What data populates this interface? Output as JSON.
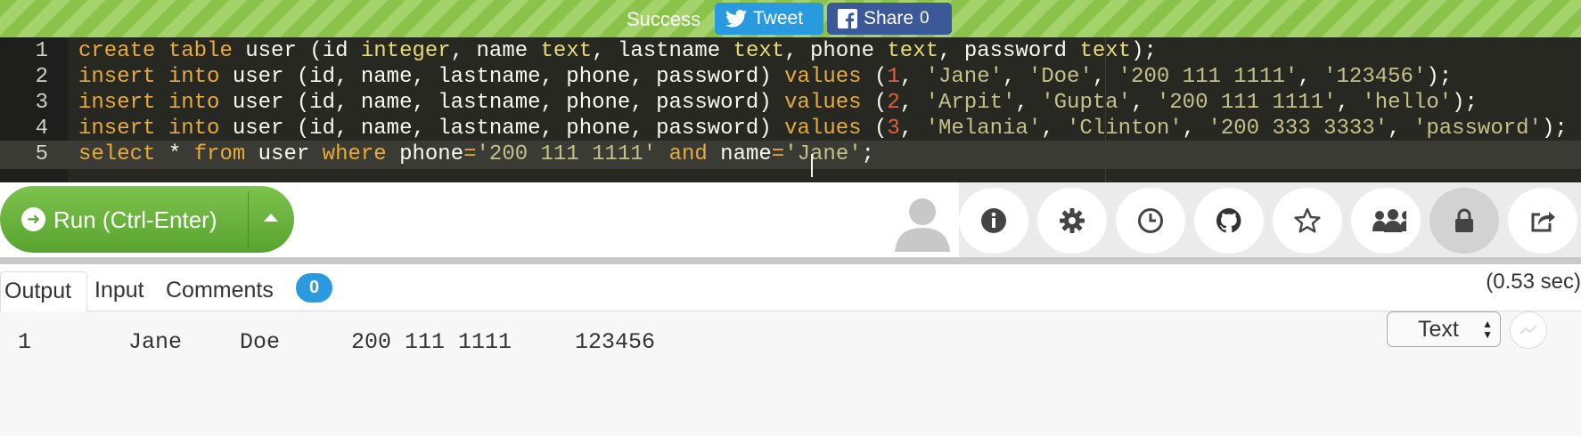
{
  "status_bar": {
    "status": "Success",
    "tweet_label": "Tweet",
    "share_label": "Share",
    "share_count": "0"
  },
  "editor": {
    "line_numbers": [
      "1",
      "2",
      "3",
      "4",
      "5"
    ],
    "lines": [
      "create table user (id integer, name text, lastname text, phone text, password text);",
      "insert into user (id, name, lastname, phone, password) values (1, 'Jane', 'Doe', '200 111 1111', '123456');",
      "insert into user (id, name, lastname, phone, password) values (2, 'Arpit', 'Gupta', '200 111 1111', 'hello');",
      "insert into user (id, name, lastname, phone, password) values (3, 'Melania', 'Clinton', '200 333 3333', 'password');",
      "select * from user where phone='200 111 1111' and name='Jane';"
    ]
  },
  "toolbar": {
    "run_label": "Run (Ctrl-Enter)",
    "icons": [
      "info-icon",
      "gear-icon",
      "history-icon",
      "github-icon",
      "star-icon",
      "users-icon",
      "lock-icon",
      "share-out-icon"
    ]
  },
  "tabs": {
    "output": "Output",
    "input": "Input",
    "comments": "Comments",
    "comments_count": "0"
  },
  "exec_time": "(0.53 sec)",
  "output": {
    "row": [
      "1",
      "Jane",
      "Doe",
      "200 111 1111",
      "123456"
    ],
    "format": "Text"
  },
  "colors": {
    "success_green": "#8bc34a",
    "run_green": "#58a32f",
    "tweet_blue": "#2a9ae0",
    "facebook_blue": "#3b5998",
    "editor_bg": "#272822"
  }
}
